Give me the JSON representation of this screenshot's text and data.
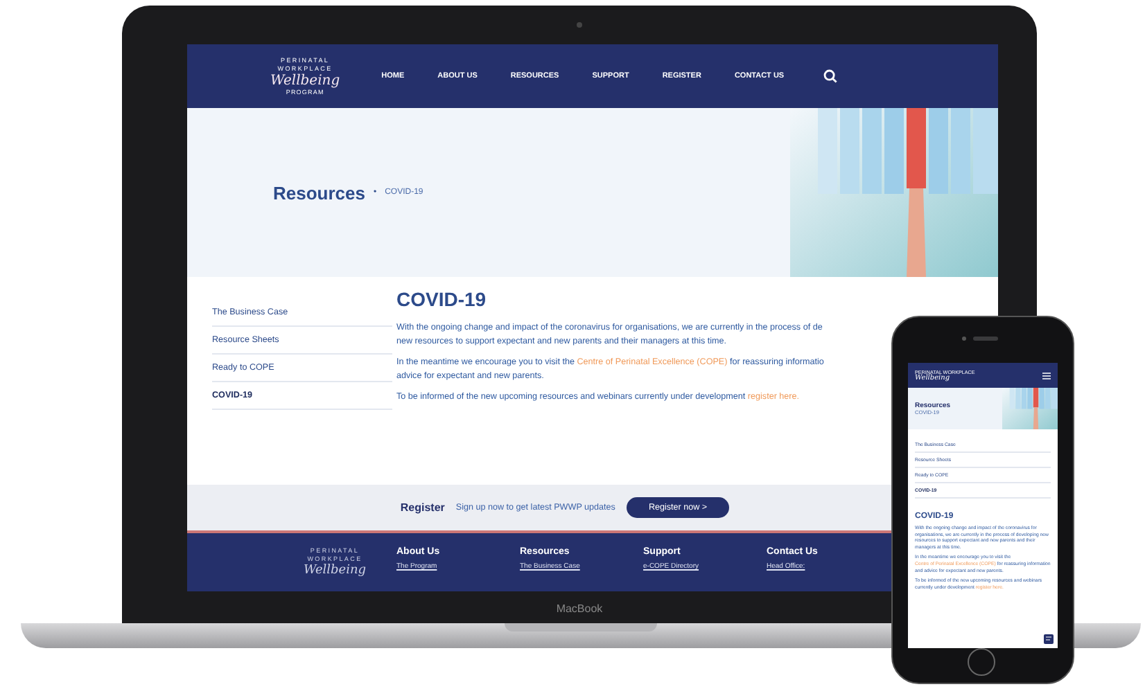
{
  "laptop": {
    "nav": {
      "logo": [
        "PERINATAL",
        "WORKPLACE",
        "Wellbeing",
        "PROGRAM"
      ],
      "items": [
        "HOME",
        "ABOUT US",
        "RESOURCES",
        "SUPPORT",
        "REGISTER",
        "CONTACT US"
      ]
    },
    "hero": {
      "title": "Resources",
      "separator": "•",
      "crumb": "COVID-19"
    },
    "sidebar": [
      {
        "label": "The Business Case",
        "selected": false
      },
      {
        "label": "Resource Sheets",
        "selected": false
      },
      {
        "label": "Ready to COPE",
        "selected": false
      },
      {
        "label": "COVID-19",
        "selected": true
      }
    ],
    "article": {
      "heading": "COVID-19",
      "paragraphs": [
        [
          [
            {
              "kind": "text",
              "text": "With the ongoing change and impact of the coronavirus for organisations, we are currently in the process of de"
            }
          ],
          [
            {
              "kind": "text",
              "text": "new resources to support expectant and new parents and their managers at this time."
            }
          ]
        ],
        [
          [
            {
              "kind": "text",
              "text": "In the meantime we encourage you to visit the "
            },
            {
              "kind": "link",
              "text": "Centre of Perinatal Excellence (COPE)"
            },
            {
              "kind": "text",
              "text": " for reassuring informatio"
            }
          ],
          [
            {
              "kind": "text",
              "text": "advice for expectant and new parents."
            }
          ]
        ],
        [
          [
            {
              "kind": "text",
              "text": "To be informed of the new upcoming resources and webinars currently under development "
            },
            {
              "kind": "link",
              "text": "register here."
            }
          ]
        ]
      ]
    },
    "register": {
      "label": "Register",
      "text": "Sign up now to get latest PWWP updates",
      "button": "Register now >"
    },
    "footer": {
      "logo": [
        "PERINATAL",
        "WORKPLACE",
        "Wellbeing"
      ],
      "columns": [
        {
          "heading": "About Us",
          "link": "The Program"
        },
        {
          "heading": "Resources",
          "link": "The Business Case"
        },
        {
          "heading": "Support",
          "link": "e-COPE Directory"
        },
        {
          "heading": "Contact Us",
          "link": "Head Office:"
        }
      ]
    },
    "device_label": "MacBook"
  },
  "phone": {
    "logo": [
      "PERINATAL WORKPLACE",
      "Wellbeing"
    ],
    "hero": {
      "title": "Resources",
      "crumb": "COVID-19"
    },
    "sidebar": [
      {
        "label": "The Business Case",
        "selected": false
      },
      {
        "label": "Resource Sheets",
        "selected": false
      },
      {
        "label": "Ready to COPE",
        "selected": false
      },
      {
        "label": "COVID-19",
        "selected": true
      }
    ],
    "heading": "COVID-19",
    "paragraphs": [
      [
        {
          "kind": "text",
          "text": "With the ongoing change and impact of the coronavirus for organisations, we are currently in the process of developing new resources to support expectant and new parents and their managers at this time."
        }
      ],
      [
        {
          "kind": "text",
          "text": "In the meantime we encourage you to visit the "
        },
        {
          "kind": "link",
          "text": "Centre of Perinatal Excellence (COPE)"
        },
        {
          "kind": "text",
          "text": " for reassuring information and advice for expectant and new parents."
        }
      ],
      [
        {
          "kind": "text",
          "text": "To be informed of the new upcoming resources and webinars currently under development "
        },
        {
          "kind": "link",
          "text": "register here."
        }
      ]
    ]
  }
}
